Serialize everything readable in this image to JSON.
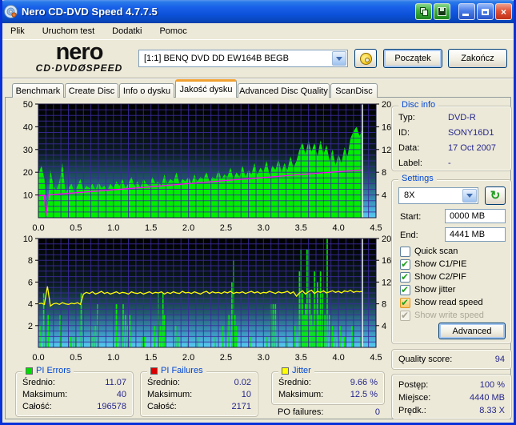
{
  "window": {
    "title": "Nero CD-DVD Speed 4.7.7.5"
  },
  "titlebar": {
    "buttons": [
      "copy",
      "save",
      "minimize",
      "maximize",
      "close"
    ]
  },
  "menu": {
    "items": [
      {
        "label": "Plik"
      },
      {
        "label": "Uruchom test"
      },
      {
        "label": "Dodatki"
      },
      {
        "label": "Pomoc"
      }
    ]
  },
  "brand": {
    "top": "nero",
    "bottom": "CD·DVDØSPEED"
  },
  "toolbar": {
    "drive": "[1:1]   BENQ DVD DD EW164B BEGB",
    "start_label": "Początek",
    "stop_label": "Zakończ"
  },
  "tabs": [
    {
      "label": "Benchmark"
    },
    {
      "label": "Create Disc"
    },
    {
      "label": "Info o dysku"
    },
    {
      "label": "Jakość dysku"
    },
    {
      "label": "Advanced Disc Quality"
    },
    {
      "label": "ScanDisc"
    }
  ],
  "active_tab": "Jakość dysku",
  "disc_info": {
    "title": "Disc info",
    "rows": [
      {
        "label": "Typ:",
        "value": "DVD-R"
      },
      {
        "label": "ID:",
        "value": "SONY16D1"
      },
      {
        "label": "Data:",
        "value": "17 Oct 2007"
      },
      {
        "label": "Label:",
        "value": "-"
      }
    ]
  },
  "settings": {
    "title": "Settings",
    "speed": "8X",
    "start": {
      "label": "Start:",
      "value": "0000 MB"
    },
    "end": {
      "label": "End:",
      "value": "4441 MB"
    },
    "checkboxes": [
      {
        "label": "Quick scan",
        "checked": false
      },
      {
        "label": "Show C1/PIE",
        "checked": true
      },
      {
        "label": "Show C2/PIF",
        "checked": true
      },
      {
        "label": "Show jitter",
        "checked": true
      },
      {
        "label": "Show read speed",
        "checked": true,
        "focused": true
      },
      {
        "label": "Show write speed",
        "checked": true,
        "disabled": true
      }
    ],
    "advanced_label": "Advanced"
  },
  "quality": {
    "label": "Quality score:",
    "value": "94"
  },
  "progress": {
    "rows": [
      {
        "label": "Postęp:",
        "value": "100 %"
      },
      {
        "label": "Miejsce:",
        "value": "4440 MB"
      },
      {
        "label": "Prędk.:",
        "value": "8.33 X"
      }
    ]
  },
  "stats": {
    "pi_errors": {
      "title": "PI Errors",
      "marker_color": "#00DD00",
      "rows": [
        {
          "label": "Średnio:",
          "value": "11.07"
        },
        {
          "label": "Maksimum:",
          "value": "40"
        },
        {
          "label": "Całość:",
          "value": "196578"
        }
      ]
    },
    "pi_failures": {
      "title": "PI Failures",
      "marker_color": "#DD0000",
      "rows": [
        {
          "label": "Średnio:",
          "value": "0.02"
        },
        {
          "label": "Maksimum:",
          "value": "10"
        },
        {
          "label": "Całość:",
          "value": "2171"
        }
      ]
    },
    "jitter": {
      "title": "Jitter",
      "marker_color": "#FFFF00",
      "rows": [
        {
          "label": "Średnio:",
          "value": "9.66 %"
        },
        {
          "label": "Maksimum:",
          "value": "12.5 %"
        }
      ]
    },
    "po_failures": {
      "label": "PO failures:",
      "value": "0"
    }
  },
  "chart_data": [
    {
      "type": "area",
      "name": "pi_errors_vs_position",
      "xlim": [
        0,
        4.5
      ],
      "x_ticks": [
        0,
        0.5,
        1,
        1.5,
        2,
        2.5,
        3,
        3.5,
        4,
        4.5
      ],
      "left_ylim": [
        0,
        50
      ],
      "left_ticks": [
        10,
        20,
        30,
        40,
        50
      ],
      "right_ylim": [
        0,
        20
      ],
      "right_ticks": [
        4,
        8,
        12,
        16,
        20
      ],
      "data_end_x": 4.32,
      "grid": true,
      "series": [
        {
          "name": "pi-errors",
          "type": "area",
          "axis": "left",
          "color": "#00EE00",
          "x_start": 0,
          "x_step": 0.04,
          "values": [
            19,
            23,
            17,
            2,
            21,
            14,
            12,
            16,
            24,
            11,
            13,
            15,
            11,
            14,
            17,
            12,
            14,
            13,
            15,
            12,
            16,
            13,
            14,
            12,
            15,
            13,
            16,
            14,
            17,
            13,
            15,
            18,
            14,
            16,
            13,
            17,
            15,
            14,
            18,
            15,
            16,
            14,
            19,
            15,
            17,
            16,
            20,
            15,
            17,
            16,
            18,
            15,
            19,
            16,
            18,
            17,
            20,
            16,
            18,
            17,
            21,
            17,
            19,
            18,
            22,
            17,
            20,
            18,
            23,
            18,
            21,
            19,
            24,
            19,
            22,
            20,
            25,
            19,
            23,
            21,
            26,
            20,
            24,
            21,
            27,
            22,
            25,
            30,
            33,
            28,
            34,
            29,
            33,
            27,
            34,
            28,
            32,
            25,
            30,
            23,
            28,
            24,
            31,
            27,
            35,
            38,
            40,
            36,
            39
          ]
        },
        {
          "name": "read-speed",
          "type": "line",
          "axis": "right",
          "color": "#FF00FF",
          "points": [
            [
              0,
              3.85
            ],
            [
              0.08,
              3.95
            ],
            [
              0.1,
              0.3
            ],
            [
              0.13,
              4.0
            ],
            [
              0.5,
              4.4
            ],
            [
              1,
              4.9
            ],
            [
              1.5,
              5.45
            ],
            [
              2,
              6.0
            ],
            [
              2.5,
              6.55
            ],
            [
              3,
              7.05
            ],
            [
              3.5,
              7.6
            ],
            [
              4,
              8.1
            ],
            [
              4.32,
              8.4
            ]
          ]
        }
      ]
    },
    {
      "type": "bar",
      "name": "pi_failures_and_jitter_vs_position",
      "xlim": [
        0,
        4.5
      ],
      "x_ticks": [
        0,
        0.5,
        1,
        1.5,
        2,
        2.5,
        3,
        3.5,
        4,
        4.5
      ],
      "left_ylim": [
        0,
        10
      ],
      "left_ticks": [
        2,
        4,
        6,
        8,
        10
      ],
      "right_ylim": [
        0,
        20
      ],
      "right_ticks": [
        4,
        8,
        12,
        16,
        20
      ],
      "data_end_x": 4.32,
      "grid": true,
      "series": [
        {
          "name": "pi-failures",
          "type": "spikes",
          "axis": "left",
          "color": "#00EE00",
          "points": [
            [
              0.02,
              2
            ],
            [
              0.07,
              5
            ],
            [
              0.1,
              1
            ],
            [
              0.13,
              3
            ],
            [
              0.29,
              3
            ],
            [
              0.42,
              1
            ],
            [
              0.44,
              1
            ],
            [
              0.47,
              1
            ],
            [
              0.5,
              1
            ],
            [
              0.57,
              5
            ],
            [
              0.7,
              2
            ],
            [
              0.73,
              1
            ],
            [
              0.76,
              2
            ],
            [
              0.79,
              4
            ],
            [
              1.0,
              1
            ],
            [
              1.04,
              4
            ],
            [
              1.08,
              1
            ],
            [
              1.13,
              4
            ],
            [
              1.16,
              3
            ],
            [
              1.19,
              2
            ],
            [
              1.22,
              3
            ],
            [
              1.38,
              1
            ],
            [
              1.41,
              1
            ],
            [
              1.55,
              2
            ],
            [
              1.6,
              5
            ],
            [
              1.63,
              2
            ],
            [
              1.66,
              5
            ],
            [
              1.68,
              3
            ],
            [
              1.83,
              2
            ],
            [
              1.86,
              1
            ],
            [
              1.99,
              1
            ],
            [
              2.12,
              1
            ],
            [
              2.36,
              1
            ],
            [
              2.46,
              2
            ],
            [
              2.54,
              3
            ],
            [
              2.58,
              6
            ],
            [
              2.6,
              8
            ],
            [
              2.62,
              3
            ],
            [
              2.64,
              2
            ],
            [
              2.82,
              1
            ],
            [
              3.05,
              1
            ],
            [
              3.1,
              4
            ],
            [
              3.13,
              4
            ],
            [
              3.16,
              4
            ],
            [
              3.19,
              1
            ],
            [
              3.32,
              1
            ],
            [
              3.42,
              2
            ],
            [
              3.48,
              7
            ],
            [
              3.5,
              9
            ],
            [
              3.52,
              5
            ],
            [
              3.54,
              3
            ],
            [
              3.56,
              4
            ],
            [
              3.58,
              9
            ],
            [
              3.6,
              9
            ],
            [
              3.62,
              5
            ],
            [
              3.64,
              3
            ],
            [
              3.66,
              2
            ],
            [
              3.68,
              7
            ],
            [
              3.7,
              4
            ],
            [
              3.72,
              6
            ],
            [
              3.74,
              3
            ],
            [
              3.76,
              7
            ],
            [
              3.79,
              5
            ],
            [
              3.82,
              3
            ],
            [
              3.85,
              10
            ],
            [
              3.88,
              3
            ],
            [
              3.92,
              2
            ],
            [
              3.96,
              1
            ],
            [
              4.02,
              2
            ],
            [
              4.08,
              1
            ],
            [
              4.18,
              2
            ],
            [
              4.3,
              1
            ]
          ]
        },
        {
          "name": "jitter",
          "type": "line",
          "axis": "right",
          "color": "#FFFF00",
          "x_start": 0,
          "x_step": 0.04,
          "values": [
            8,
            8.1,
            7.9,
            11.2,
            7.6,
            8,
            8.1,
            7.9,
            8.2,
            8,
            7.9,
            8.1,
            8,
            8.2,
            7.9,
            9.8,
            10.1,
            9.9,
            10.2,
            9.8,
            10,
            10.3,
            9.9,
            10.1,
            9.8,
            10,
            10.2,
            9.9,
            10.1,
            10,
            9.8,
            10.2,
            10,
            9.9,
            10.1,
            9.8,
            10,
            10.2,
            9.9,
            10.1,
            10,
            10.2,
            9.8,
            10.1,
            9.9,
            10.2,
            10,
            9.9,
            10.3,
            10,
            10.1,
            9.9,
            10.2,
            10,
            9.8,
            10.1,
            10.3,
            9.9,
            10.2,
            10,
            10.1,
            9.9,
            10.2,
            10,
            10.3,
            9.9,
            10.1,
            10,
            10.2,
            9.9,
            10.1,
            10.3,
            10,
            10.2,
            9.9,
            10.1,
            10,
            10.3,
            10.1,
            9.9,
            10.2,
            10,
            10.1,
            10.3,
            9.9,
            10.2,
            9.4,
            10,
            10.4,
            9.8,
            10.2,
            10.5,
            9.9,
            10.3,
            10.1,
            10.4,
            10,
            10.2,
            10.4,
            10.1,
            10.3,
            10,
            10.4,
            10.2,
            10.5,
            10.1,
            10.3,
            10.2,
            10.3
          ]
        }
      ]
    }
  ]
}
